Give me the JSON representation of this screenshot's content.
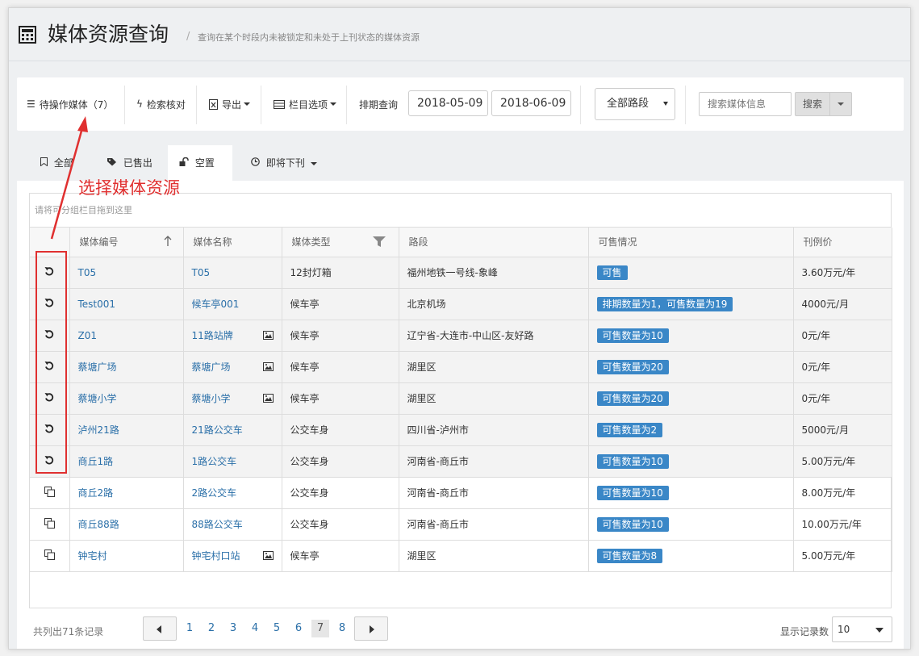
{
  "header": {
    "title": "媒体资源查询",
    "separator": "/",
    "subtitle": "查询在某个时段内未被锁定和未处于上刊状态的媒体资源"
  },
  "toolbar": {
    "pending_media": "待操作媒体（7）",
    "check": "检索核对",
    "export": "导出",
    "columns": "栏目选项",
    "schedule_query": "排期查询",
    "date_start": "2018-05-09",
    "date_end": "2018-06-09",
    "route_select": "全部路段",
    "search_placeholder": "搜索媒体信息",
    "search_button": "搜索"
  },
  "tabs": [
    {
      "label": "全部",
      "icon": "bookmark-icon"
    },
    {
      "label": "已售出",
      "icon": "tag-icon"
    },
    {
      "label": "空置",
      "icon": "unlock-icon"
    },
    {
      "label": "即将下刊",
      "icon": "clock-icon"
    }
  ],
  "grid": {
    "group_hint": "请将可分组栏目拖到这里",
    "columns": [
      "媒体编号",
      "媒体名称",
      "媒体类型",
      "路段",
      "可售情况",
      "刊例价"
    ],
    "rows": [
      {
        "code": "T05",
        "name": "T05",
        "type": "12封灯箱",
        "route": "福州地铁一号线-象峰",
        "status": "可售",
        "price": "3.60万元/年",
        "locked": true,
        "has_image": false
      },
      {
        "code": "Test001",
        "name": "候车亭001",
        "type": "候车亭",
        "route": "北京机场",
        "status": "排期数量为1，可售数量为19",
        "price": "4000元/月",
        "locked": true,
        "has_image": false
      },
      {
        "code": "Z01",
        "name": "11路站牌",
        "type": "候车亭",
        "route": "辽宁省-大连市-中山区-友好路",
        "status": "可售数量为10",
        "price": "0元/年",
        "locked": true,
        "has_image": true
      },
      {
        "code": "蔡塘广场",
        "name": "蔡塘广场",
        "type": "候车亭",
        "route": "湖里区",
        "status": "可售数量为20",
        "price": "0元/年",
        "locked": true,
        "has_image": true
      },
      {
        "code": "蔡塘小学",
        "name": "蔡塘小学",
        "type": "候车亭",
        "route": "湖里区",
        "status": "可售数量为20",
        "price": "0元/年",
        "locked": true,
        "has_image": true
      },
      {
        "code": "泸州21路",
        "name": "21路公交车",
        "type": "公交车身",
        "route": "四川省-泸州市",
        "status": "可售数量为2",
        "price": "5000元/月",
        "locked": true,
        "has_image": false
      },
      {
        "code": "商丘1路",
        "name": "1路公交车",
        "type": "公交车身",
        "route": "河南省-商丘市",
        "status": "可售数量为10",
        "price": "5.00万元/年",
        "locked": true,
        "has_image": false
      },
      {
        "code": "商丘2路",
        "name": "2路公交车",
        "type": "公交车身",
        "route": "河南省-商丘市",
        "status": "可售数量为10",
        "price": "8.00万元/年",
        "locked": false,
        "has_image": false
      },
      {
        "code": "商丘88路",
        "name": "88路公交车",
        "type": "公交车身",
        "route": "河南省-商丘市",
        "status": "可售数量为10",
        "price": "10.00万元/年",
        "locked": false,
        "has_image": false
      },
      {
        "code": "钟宅村",
        "name": "钟宅村口站",
        "type": "候车亭",
        "route": "湖里区",
        "status": "可售数量为8",
        "price": "5.00万元/年",
        "locked": false,
        "has_image": true
      }
    ]
  },
  "pager": {
    "total": "共列出71条记录",
    "pages": [
      "1",
      "2",
      "3",
      "4",
      "5",
      "6",
      "7",
      "8"
    ],
    "active_page": "7",
    "perpage_label": "显示记录数",
    "perpage_value": "10"
  },
  "annotation": {
    "text": "选择媒体资源",
    "color": "#e03030"
  },
  "colors": {
    "link": "#2a6fa8",
    "badge": "#3a87c7"
  }
}
